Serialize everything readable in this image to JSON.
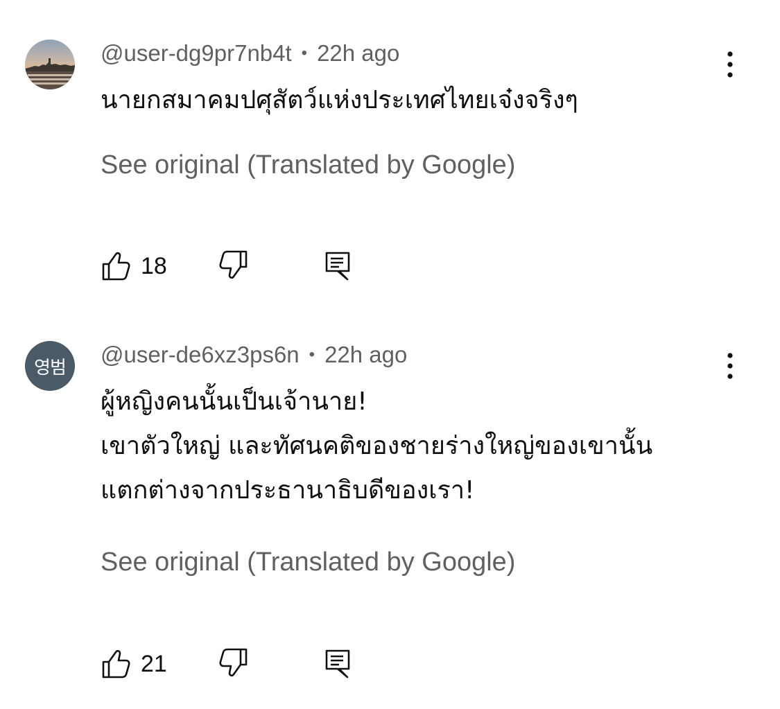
{
  "comments": [
    {
      "author": "@user-dg9pr7nb4t",
      "time": "22h ago",
      "avatar": {
        "kind": "photo",
        "description": "city-skyline-avatar"
      },
      "text_lines": [
        "นายกสมาคมปศุสัตว์แห่งประเทศไทยเจ๋งจริงๆ"
      ],
      "see_original": "See original (Translated by Google)",
      "likes": "18"
    },
    {
      "author": "@user-de6xz3ps6n",
      "time": "22h ago",
      "avatar": {
        "kind": "initials",
        "initials": "영범",
        "color": "#4a5a66"
      },
      "text_lines": [
        "ผู้หญิงคนนั้นเป็นเจ้านาย!",
        "เขาตัวใหญ่ และทัศนคติของชายร่างใหญ่ของเขานั้น",
        "แตกต่างจากประธานาธิบดีของเรา!"
      ],
      "see_original": "See original (Translated by Google)",
      "likes": "21"
    }
  ],
  "meta_separator": "•",
  "icons": {
    "like": "thumbs-up-icon",
    "dislike": "thumbs-down-icon",
    "reply": "reply-comment-icon",
    "more": "more-vertical-icon"
  },
  "colors": {
    "text_primary": "#0f0f0f",
    "text_secondary": "#606060",
    "background": "#ffffff"
  }
}
